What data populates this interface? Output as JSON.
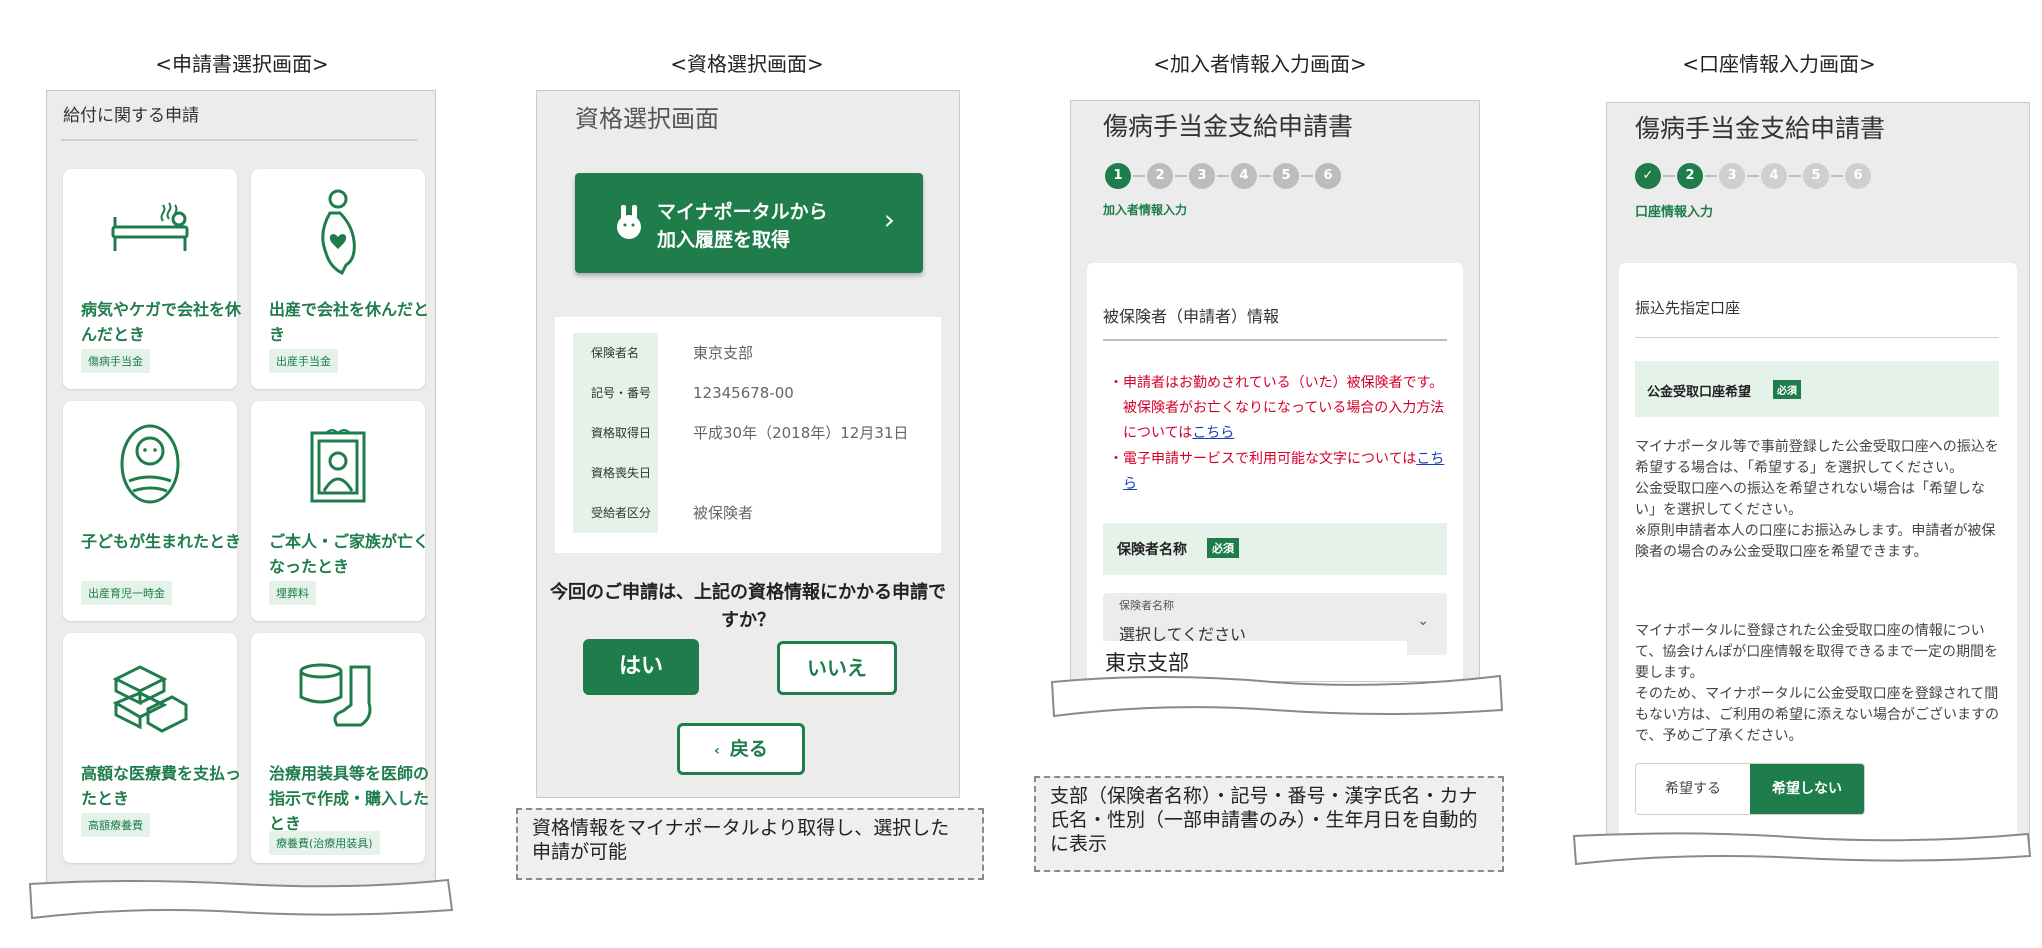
{
  "headings": [
    "<申請書選択画面>",
    "<資格選択画面>",
    "<加入者情報入力画面>",
    "<口座情報入力画面>"
  ],
  "panel1": {
    "section_title": "給付に関する申請",
    "cards": [
      {
        "title": "病気やケガで会社を休んだとき",
        "tag": "傷病手当金",
        "icon": "bed-icon"
      },
      {
        "title": "出産で会社を休んだとき",
        "tag": "出産手当金",
        "icon": "pregnant-icon"
      },
      {
        "title": "子どもが生まれたとき",
        "tag": "出産育児一時金",
        "icon": "baby-icon"
      },
      {
        "title": "ご本人・ご家族が亡くなったとき",
        "tag": "埋葬料",
        "icon": "portrait-icon"
      },
      {
        "title": "高額な医療費を支払ったとき",
        "tag": "高額療養費",
        "icon": "money-stack-icon"
      },
      {
        "title": "治療用装具等を医師の指示で作成・購入したとき",
        "tag": "療養費(治療用装具)",
        "icon": "brace-icon"
      }
    ]
  },
  "panel2": {
    "title": "資格選択画面",
    "mynaportal_button": {
      "line1": "マイナポータルから",
      "line2": "加入履歴を取得"
    },
    "rows": [
      {
        "label": "保険者名",
        "value": "東京支部"
      },
      {
        "label": "記号・番号",
        "value": "12345678-00"
      },
      {
        "label": "資格取得日",
        "value": "平成30年（2018年）12月31日"
      },
      {
        "label": "資格喪失日",
        "value": ""
      },
      {
        "label": "受給者区分",
        "value": "被保険者"
      }
    ],
    "question": "今回のご申請は、上記の資格情報にかかる申請ですか？",
    "yes": "はい",
    "no": "いいえ",
    "back": "戻る",
    "caption": "資格情報をマイナポータルより取得し、選択した申請が可能"
  },
  "panel3": {
    "title": "傷病手当金支給申請書",
    "steps": [
      "1",
      "2",
      "3",
      "4",
      "5",
      "6"
    ],
    "step_label": "加入者情報入力",
    "section": "被保険者（申請者）情報",
    "bullet1_a": "申請者はお勤めされている（いた）被保険者です。被保険者がお亡くなりになっている場合の入力方法については",
    "bullet1_link": "こちら",
    "bullet2_a": "電子申請サービスで利用可能な文字については",
    "bullet2_link": "こちら",
    "field_label": "保険者名称",
    "required": "必須",
    "select_small_label": "保険者名称",
    "select_placeholder": "選択してください",
    "option_shown": "東京支部",
    "caption": "支部（保険者名称）・記号・番号・漢字氏名・カナ氏名・性別（一部申請書のみ）・生年月日を自動的に表示"
  },
  "panel4": {
    "title": "傷病手当金支給申請書",
    "steps": [
      "✓",
      "2",
      "3",
      "4",
      "5",
      "6"
    ],
    "step_label": "口座情報入力",
    "section": "振込先指定口座",
    "field_label": "公金受取口座希望",
    "required": "必須",
    "p1": "マイナポータル等で事前登録した公金受取口座への振込を希望する場合は、「希望する」を選択してください。",
    "p2": "公金受取口座への振込を希望されない場合は「希望しない」を選択してください。",
    "p3": "※原則申請者本人の口座にお振込みします。申請者が被保険者の場合のみ公金受取口座を希望できます。",
    "p4": "マイナポータルに登録された公金受取口座の情報について、協会けんぽが口座情報を取得できるまで一定の期間を要します。",
    "p5": "そのため、マイナポータルに公金受取口座を登録されて間もない方は、ご利用の希望に添えない場合がございますので、予めご了承ください。",
    "opt_yes": "希望する",
    "opt_no": "希望しない"
  },
  "colors": {
    "brand_green": "#1e7d4b",
    "light_green": "#e4f2e9",
    "red": "#d6002a"
  }
}
